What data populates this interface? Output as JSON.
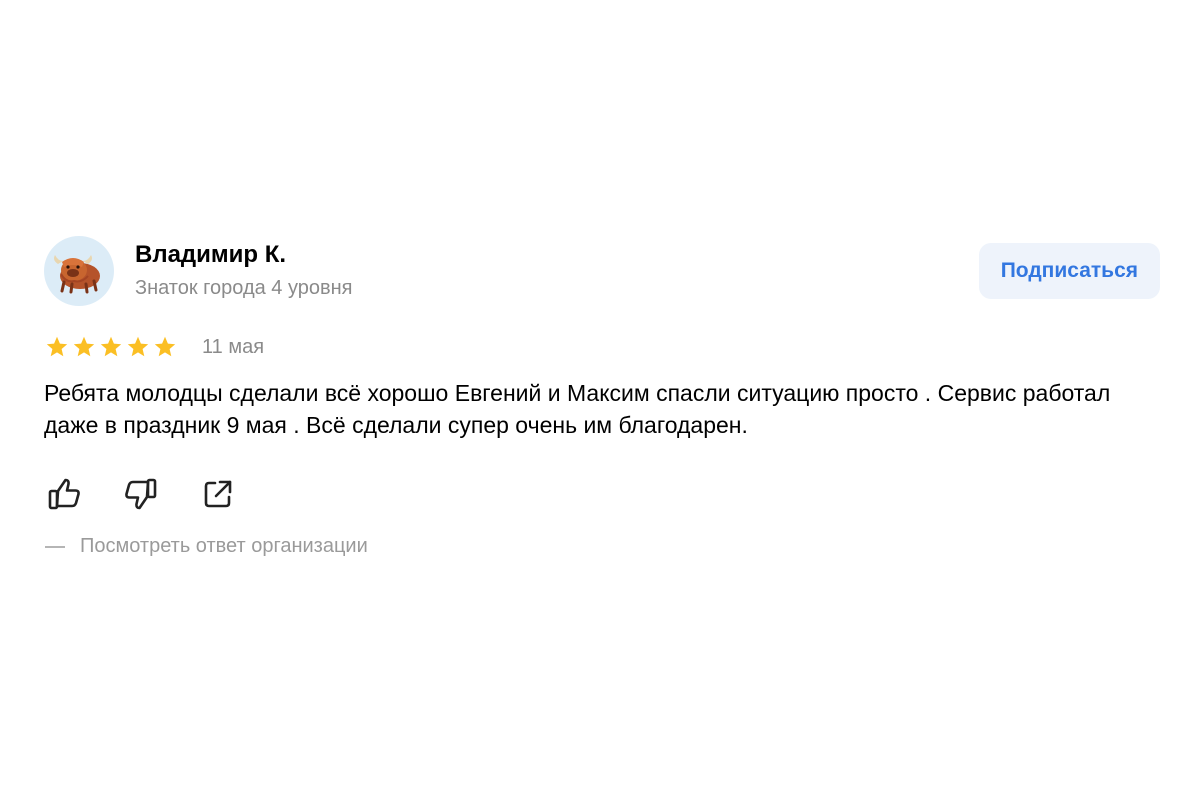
{
  "review": {
    "author": {
      "name": "Владимир К.",
      "level": "Знаток города 4 уровня",
      "avatar_icon": "yak-avatar"
    },
    "subscribe_label": "Подписаться",
    "rating": {
      "value": 5,
      "max": 5,
      "star_color": "#fbbf24"
    },
    "date": "11 мая",
    "text": "Ребята молодцы сделали всё хорошо Евгений и Максим спасли ситуацию просто . Сервис работал даже в праздник 9 мая . Всё сделали супер очень им благодарен.",
    "actions": [
      {
        "icon": "thumbs-up-icon"
      },
      {
        "icon": "thumbs-down-icon"
      },
      {
        "icon": "share-icon"
      }
    ],
    "org_reply_label": "Посмотреть ответ организации"
  },
  "colors": {
    "accent": "#3377e0",
    "button_bg": "#eef3fb",
    "muted_text": "#8a8a8a"
  }
}
